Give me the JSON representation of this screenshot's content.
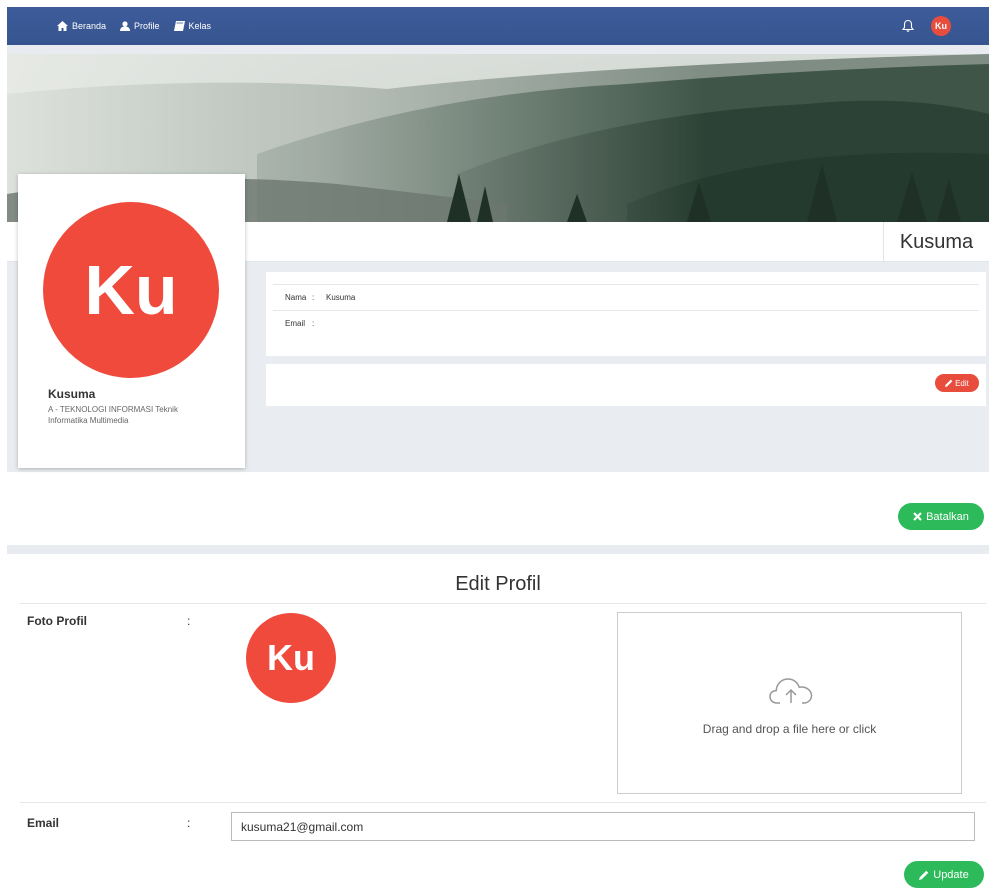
{
  "nav": {
    "items": [
      {
        "label": "Beranda",
        "icon": "home-icon"
      },
      {
        "label": "Profile",
        "icon": "user-icon"
      },
      {
        "label": "Kelas",
        "icon": "book-icon"
      }
    ],
    "avatar_initials": "Ku",
    "bell_icon": "bell-icon"
  },
  "profile": {
    "header_name": "Kusuma",
    "avatar_initials": "Ku",
    "card_name": "Kusuma",
    "card_subtitle": "A - TEKNOLOGI INFORMASI Teknik Informatika Multimedia",
    "info": {
      "nama_label": "Nama",
      "nama_sep": ":",
      "nama_value": "Kusuma",
      "email_label": "Email",
      "email_sep": ":",
      "email_value": ""
    },
    "edit_button": "Edit"
  },
  "actions": {
    "cancel_label": "Batalkan"
  },
  "edit_form": {
    "title": "Edit Profil",
    "photo_label": "Foto Profil",
    "photo_colon": ":",
    "photo_initials": "Ku",
    "dropzone_text": "Drag and drop a file here or click",
    "email_label": "Email",
    "email_colon": ":",
    "email_value": "kusuma21@gmail.com",
    "update_label": "Update"
  },
  "colors": {
    "nav_bg": "#3b5998",
    "avatar_red": "#f04a3c",
    "edit_red": "#e74c3c",
    "success_green": "#2dba5a",
    "grey_bg": "#e9ecf0"
  }
}
